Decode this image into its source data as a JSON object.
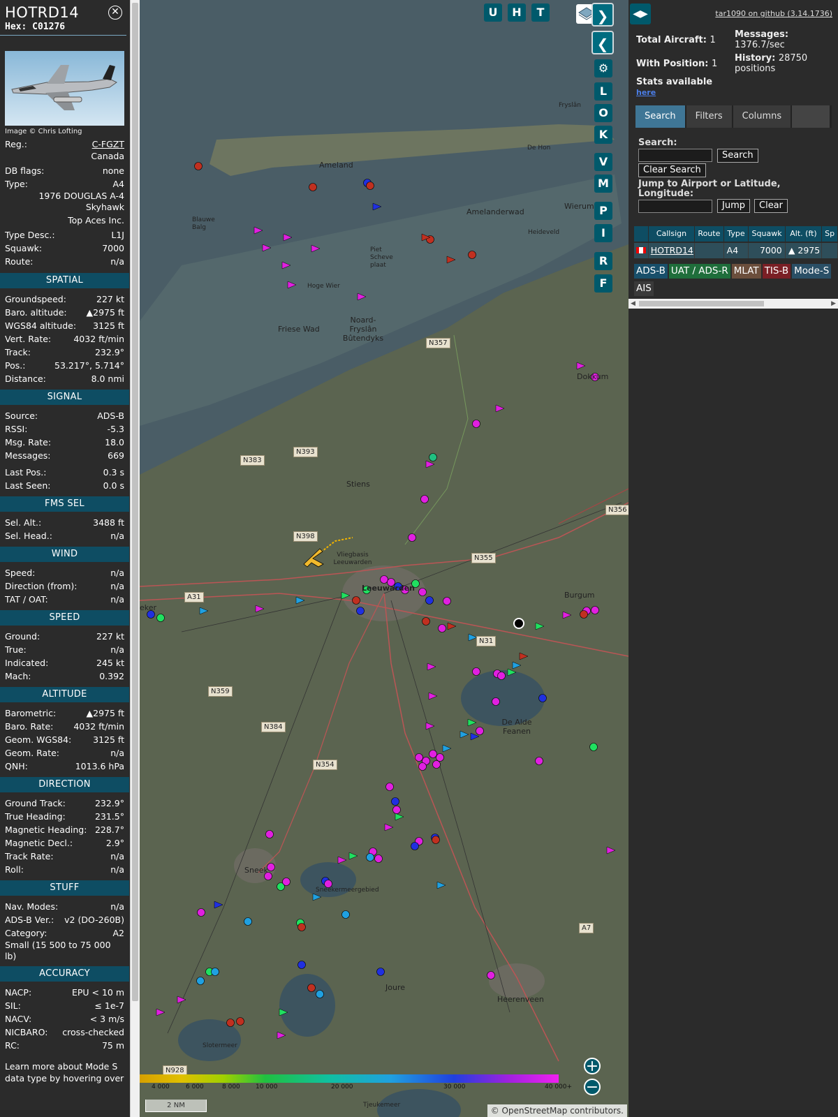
{
  "aircraft": {
    "callsign": "HOTRD14",
    "hex_label": "Hex:",
    "hex": "C01276",
    "image_credit": "Image © Chris Lofting",
    "details": [
      {
        "label": "Reg.:",
        "value": "C-FGZT",
        "link": true
      },
      {
        "label": "",
        "value": "Canada"
      },
      {
        "label": "DB flags:",
        "value": "none"
      },
      {
        "label": "Type:",
        "value": "A4"
      },
      {
        "label": "",
        "value": "1976 DOUGLAS A-4 Skyhawk"
      },
      {
        "label": "",
        "value": "Top Aces Inc."
      },
      {
        "label": "Type Desc.:",
        "value": "L1J"
      },
      {
        "label": "Squawk:",
        "value": "7000"
      },
      {
        "label": "Route:",
        "value": "n/a"
      }
    ],
    "sections": [
      {
        "title": "SPATIAL",
        "rows": [
          {
            "label": "Groundspeed:",
            "value": "227 kt"
          },
          {
            "label": "Baro. altitude:",
            "value": "▲2975 ft"
          },
          {
            "label": "WGS84 altitude:",
            "value": "3125 ft"
          },
          {
            "label": "Vert. Rate:",
            "value": "4032 ft/min"
          },
          {
            "label": "Track:",
            "value": "232.9°"
          },
          {
            "label": "Pos.:",
            "value": "53.217°, 5.714°"
          },
          {
            "label": "Distance:",
            "value": "8.0 nmi"
          }
        ]
      },
      {
        "title": "SIGNAL",
        "rows": [
          {
            "label": "Source:",
            "value": "ADS-B"
          },
          {
            "label": "RSSI:",
            "value": "-5.3"
          },
          {
            "label": "Msg. Rate:",
            "value": "18.0"
          },
          {
            "label": "Messages:",
            "value": "669"
          },
          {
            "label": "",
            "value": ""
          },
          {
            "label": "Last Pos.:",
            "value": "0.3 s"
          },
          {
            "label": "Last Seen:",
            "value": "0.0 s"
          }
        ]
      },
      {
        "title": "FMS SEL",
        "rows": [
          {
            "label": "Sel. Alt.:",
            "value": "3488 ft"
          },
          {
            "label": "Sel. Head.:",
            "value": "n/a"
          }
        ]
      },
      {
        "title": "WIND",
        "rows": [
          {
            "label": "Speed:",
            "value": "n/a"
          },
          {
            "label": "Direction (from):",
            "value": "n/a"
          },
          {
            "label": "TAT / OAT:",
            "value": "n/a"
          }
        ]
      },
      {
        "title": "SPEED",
        "rows": [
          {
            "label": "Ground:",
            "value": "227 kt"
          },
          {
            "label": "True:",
            "value": "n/a"
          },
          {
            "label": "Indicated:",
            "value": "245 kt"
          },
          {
            "label": "Mach:",
            "value": "0.392"
          }
        ]
      },
      {
        "title": "ALTITUDE",
        "rows": [
          {
            "label": "Barometric:",
            "value": "▲2975 ft"
          },
          {
            "label": "Baro. Rate:",
            "value": "4032 ft/min"
          },
          {
            "label": "Geom. WGS84:",
            "value": "3125 ft"
          },
          {
            "label": "Geom. Rate:",
            "value": "n/a"
          },
          {
            "label": "QNH:",
            "value": "1013.6 hPa"
          }
        ]
      },
      {
        "title": "DIRECTION",
        "rows": [
          {
            "label": "Ground Track:",
            "value": "232.9°"
          },
          {
            "label": "True Heading:",
            "value": "231.5°"
          },
          {
            "label": "Magnetic Heading:",
            "value": "228.7°"
          },
          {
            "label": "Magnetic Decl.:",
            "value": "2.9°"
          },
          {
            "label": "Track Rate:",
            "value": "n/a"
          },
          {
            "label": "Roll:",
            "value": "n/a"
          }
        ]
      },
      {
        "title": "STUFF",
        "rows": [
          {
            "label": "Nav. Modes:",
            "value": "n/a"
          },
          {
            "label": "ADS-B Ver.:",
            "value": "v2 (DO-260B)"
          },
          {
            "label": "Category:",
            "value": "A2"
          },
          {
            "label": "Small (15 500 to 75 000 lb)",
            "value": ""
          }
        ]
      },
      {
        "title": "ACCURACY",
        "rows": [
          {
            "label": "NACP:",
            "value": "EPU < 10 m"
          },
          {
            "label": "SIL:",
            "value": "≤ 1e-7"
          },
          {
            "label": "NACV:",
            "value": "< 3 m/s"
          },
          {
            "label": "NICBARO:",
            "value": "cross-checked"
          },
          {
            "label": "RC:",
            "value": "75 m"
          }
        ]
      }
    ],
    "footer": "Learn more about Mode S data type by hovering over"
  },
  "map": {
    "buttons_top": [
      "U",
      "H",
      "T"
    ],
    "buttons_side": [
      "L",
      "O",
      "K",
      "V",
      "M",
      "P",
      "I",
      "R",
      "F"
    ],
    "places": [
      "Ameland",
      "Amelanderwad",
      "Blauwe Balg",
      "Piet Scheve plaat",
      "Hoge Wier",
      "Friese Wad",
      "Noard-Fryslân Bûtendyks",
      "Stiens",
      "Vliegbasis Leeuwarden",
      "Burgum",
      "De Alde Feanen",
      "Sneek",
      "Sneekermeergebied",
      "Joure",
      "Heerenveen",
      "Dokkum",
      "Heideveld",
      "Wierum",
      "Fryslân",
      "De Hon",
      "Slotermeer",
      "Tjeukemeer",
      "eker",
      "Leeuwarden"
    ],
    "roads": [
      "N357",
      "N393",
      "N383",
      "N398",
      "N355",
      "N356",
      "N31",
      "A31",
      "N359",
      "N384",
      "N354",
      "A7",
      "N928"
    ],
    "scale": [
      "4 000",
      "6 000",
      "8 000",
      "10 000",
      "20 000",
      "30 000",
      "40 000+"
    ],
    "scale_nm": "2 NM",
    "attribution_prefix": "©",
    "attribution_link": "OpenStreetMap",
    "attribution_suffix": "contributors."
  },
  "side": {
    "github": "tar1090 on github (3.14.1736)",
    "total_label": "Total Aircraft:",
    "total": "1",
    "pos_label": "With Position:",
    "pos": "1",
    "stats_label": "Stats available",
    "stats_link": "here",
    "msg_label": "Messages:",
    "msg": "1376.7/sec",
    "hist_label": "History:",
    "hist": "28750 positions",
    "tabs": [
      "Search",
      "Filters",
      "Columns"
    ],
    "search_label": "Search:",
    "search_btn": "Search",
    "clear_search_btn": "Clear Search",
    "jump_label": "Jump to Airport or Latitude, Longitude:",
    "jump_btn": "Jump",
    "clear_btn": "Clear",
    "columns": [
      "Callsign",
      "Route",
      "Type",
      "Squawk",
      "Alt. (ft)",
      "Sp"
    ],
    "row": {
      "callsign": "HOTRD14",
      "route": "",
      "type": "A4",
      "squawk": "7000",
      "alt": "▲ 2975"
    },
    "sources": [
      {
        "name": "ADS-B",
        "color": "#184f6a"
      },
      {
        "name": "UAT / ADS-R",
        "color": "#1f6e3b"
      },
      {
        "name": "MLAT",
        "color": "#6b4e3c"
      },
      {
        "name": "TIS-B",
        "color": "#7a1f25"
      },
      {
        "name": "Mode-S",
        "color": "#2a4f66"
      },
      {
        "name": "AIS",
        "color": "#3a3a3a"
      }
    ]
  }
}
